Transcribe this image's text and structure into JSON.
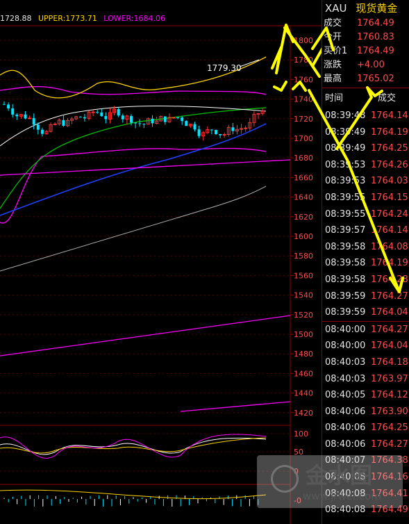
{
  "legend": {
    "mid": "1728.88",
    "upper": "UPPER:1773.71",
    "lower": "LOWER:1684.06"
  },
  "colors": {
    "up_candle": "#ff3030",
    "down_candle": "#00e5ff",
    "upper_band": "#ffd500",
    "lower_band": "#ff00ff",
    "price_red": "#ff4d4d",
    "annotation": "#ffff00"
  },
  "price_axis": {
    "ticks": [
      "1800",
      "1780",
      "1760",
      "1740",
      "1720",
      "1700",
      "1680",
      "1660",
      "1640",
      "1620",
      "1600",
      "1580",
      "1560",
      "1540",
      "1520",
      "1500",
      "1480",
      "1460",
      "1440",
      "1420"
    ]
  },
  "high_label": "1779.30",
  "indicator_axis": {
    "ticks": [
      "100",
      "50",
      "0"
    ],
    "bottom_label": "-0"
  },
  "quote": {
    "symbol": "XAU",
    "name": "现货黄金",
    "rows": [
      {
        "label": "成交",
        "value": "1764.49"
      },
      {
        "label": "今开",
        "value": "1760.83"
      },
      {
        "label": "买价1",
        "value": "1764.49"
      },
      {
        "label": "涨跌",
        "value": "+4.00"
      },
      {
        "label": "最高",
        "value": "1765.02"
      }
    ]
  },
  "ticks_table": {
    "headers": [
      "时间",
      "成交"
    ],
    "rows": [
      [
        "08:39:48",
        "1764.14"
      ],
      [
        "08:39:49",
        "1764.19"
      ],
      [
        "08:39:49",
        "1764.25"
      ],
      [
        "08:39:53",
        "1764.26"
      ],
      [
        "08:39:53",
        "1764.03"
      ],
      [
        "08:39:55",
        "1764.15"
      ],
      [
        "08:39:55",
        "1764.24"
      ],
      [
        "08:39:57",
        "1764.14"
      ],
      [
        "08:39:58",
        "1764.08"
      ],
      [
        "08:39:58",
        "1764.19"
      ],
      [
        "08:39:58",
        "1764.28"
      ],
      [
        "08:39:59",
        "1764.27"
      ],
      [
        "08:39:59",
        "1764.04"
      ],
      [
        "08:40:00",
        "1764.27"
      ],
      [
        "08:40:00",
        "1764.04"
      ],
      [
        "08:40:03",
        "1764.18"
      ],
      [
        "08:40:03",
        "1763.97"
      ],
      [
        "08:40:05",
        "1764.12"
      ],
      [
        "08:40:06",
        "1763.90"
      ],
      [
        "08:40:06",
        "1764.25"
      ],
      [
        "08:40:06",
        "1764.27"
      ],
      [
        "08:40:07",
        "1764.38"
      ],
      [
        "08:40:08",
        "1764.16"
      ],
      [
        "08:40:08",
        "1764.41"
      ],
      [
        "08:40:08",
        "1764.49"
      ]
    ]
  },
  "watermark": {
    "brand": "金水图",
    "url": "www.jrwel.com"
  }
}
